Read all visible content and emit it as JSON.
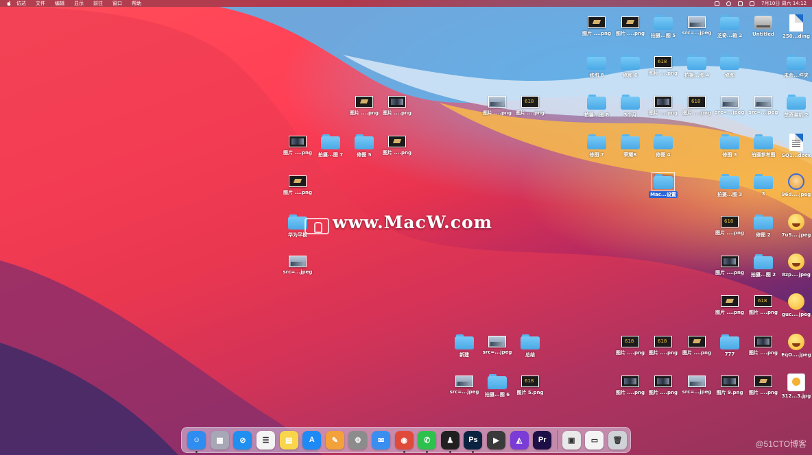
{
  "menubar": {
    "items": [
      "访达",
      "文件",
      "编辑",
      "显示",
      "前往",
      "窗口",
      "帮助"
    ],
    "clock": "7月10日 周六 14:12"
  },
  "desktop_icons": [
    {
      "label": "图片 ....png",
      "kind": "thumb",
      "style": "gold"
    },
    {
      "label": "图片 ....png",
      "kind": "thumb",
      "style": "gold"
    },
    {
      "label": "拍摄...图 5",
      "kind": "folder"
    },
    {
      "label": "src=...jpeg",
      "kind": "thumb",
      "style": "sky"
    },
    {
      "label": "芝奇...箱 2",
      "kind": "folder"
    },
    {
      "label": "Untitled",
      "kind": "drive"
    },
    {
      "label": "250...ding",
      "kind": "doc"
    },
    {
      "label": "修图 8",
      "kind": "folder"
    },
    {
      "label": "修图 6",
      "kind": "folder"
    },
    {
      "label": "图片 ....png",
      "kind": "thumb",
      "style": "six"
    },
    {
      "label": "拍摄...图 4",
      "kind": "folder"
    },
    {
      "label": "修图",
      "kind": "folder"
    },
    {
      "label": "未命...件夹",
      "kind": "folder"
    },
    {
      "label": "拍摄...图 8",
      "kind": "folder"
    },
    {
      "label": "3个月",
      "kind": "folder"
    },
    {
      "label": "图片 ....png",
      "kind": "thumb",
      "style": "dark"
    },
    {
      "label": "图片 ....png",
      "kind": "thumb",
      "style": "six"
    },
    {
      "label": "src=...jpeg",
      "kind": "thumb",
      "style": "sky"
    },
    {
      "label": "src=...jpeg",
      "kind": "thumb",
      "style": "sky"
    },
    {
      "label": "芝奇装机 2",
      "kind": "folder"
    },
    {
      "label": "修图 7",
      "kind": "folder"
    },
    {
      "label": "荣耀R",
      "kind": "folder"
    },
    {
      "label": "修图 4",
      "kind": "folder"
    },
    {
      "label": "修图 3",
      "kind": "folder"
    },
    {
      "label": "拍摄参考图",
      "kind": "folder"
    },
    {
      "label": "SQ1...docx",
      "kind": "docx"
    },
    {
      "label": "Mac...设置",
      "kind": "folder",
      "selected": true
    },
    {
      "label": "拍摄...图 3",
      "kind": "folder"
    },
    {
      "label": "3",
      "kind": "folder"
    },
    {
      "label": "96d....jpeg",
      "kind": "emoji",
      "style": "avatar"
    },
    {
      "label": "图片 ....png",
      "kind": "thumb",
      "style": "six"
    },
    {
      "label": "修图 2",
      "kind": "folder"
    },
    {
      "label": "7uS....jpeg",
      "kind": "emoji",
      "style": "fun"
    },
    {
      "label": "图片 ....png",
      "kind": "thumb",
      "style": "dark"
    },
    {
      "label": "拍摄...图 2",
      "kind": "folder"
    },
    {
      "label": "8zp....jpeg",
      "kind": "emoji",
      "style": "fun"
    },
    {
      "label": "图片 ....png",
      "kind": "thumb",
      "style": "gold"
    },
    {
      "label": "图片 ....png",
      "kind": "thumb",
      "style": "six"
    },
    {
      "label": "guc....jpeg",
      "kind": "emoji",
      "style": "plain"
    },
    {
      "label": "图片 ....png",
      "kind": "thumb",
      "style": "gold"
    },
    {
      "label": "图片 ....png",
      "kind": "thumb",
      "style": "dark"
    },
    {
      "label": "图片 ....png",
      "kind": "thumb",
      "style": "sky"
    },
    {
      "label": "图片 ....png",
      "kind": "thumb",
      "style": "six"
    },
    {
      "label": "图片 ....png",
      "kind": "thumb",
      "style": "dark"
    },
    {
      "label": "拍摄...图 7",
      "kind": "folder"
    },
    {
      "label": "修图 5",
      "kind": "folder"
    },
    {
      "label": "图片 ....png",
      "kind": "thumb",
      "style": "gold"
    },
    {
      "label": "图片 ....png",
      "kind": "thumb",
      "style": "gold"
    },
    {
      "label": "华为平板",
      "kind": "folder"
    },
    {
      "label": "src=...jpeg",
      "kind": "thumb",
      "style": "sky"
    },
    {
      "label": "新建",
      "kind": "folder"
    },
    {
      "label": "src=...jpeg",
      "kind": "thumb",
      "style": "sky"
    },
    {
      "label": "总结",
      "kind": "folder"
    },
    {
      "label": "src=...jpeg",
      "kind": "thumb",
      "style": "sky"
    },
    {
      "label": "拍摄...图 6",
      "kind": "folder"
    },
    {
      "label": "图片 5.png",
      "kind": "thumb",
      "style": "six"
    },
    {
      "label": "图片 ....png",
      "kind": "thumb",
      "style": "six"
    },
    {
      "label": "图片 ....png",
      "kind": "thumb",
      "style": "six"
    },
    {
      "label": "图片 ....png",
      "kind": "thumb",
      "style": "gold"
    },
    {
      "label": "777",
      "kind": "folder"
    },
    {
      "label": "图片 ....png",
      "kind": "thumb",
      "style": "dark"
    },
    {
      "label": "EqO....jpeg",
      "kind": "emoji",
      "style": "fun"
    },
    {
      "label": "图片 ....png",
      "kind": "thumb",
      "style": "dark"
    },
    {
      "label": "图片 ....png",
      "kind": "thumb",
      "style": "dark"
    },
    {
      "label": "src=...jpeg",
      "kind": "thumb",
      "style": "sky"
    },
    {
      "label": "图片 9.png",
      "kind": "thumb",
      "style": "dark"
    },
    {
      "label": "图片 ....png",
      "kind": "thumb",
      "style": "gold"
    },
    {
      "label": "312...3.jpg",
      "kind": "emoji",
      "style": "pic"
    }
  ],
  "watermark": "www.MacW.com",
  "credit": "@51CTO博客",
  "dock": [
    {
      "name": "finder",
      "glyph": "☺",
      "color": "#2f8cf0",
      "running": true
    },
    {
      "name": "launchpad",
      "glyph": "▦",
      "color": "#a7a7b5"
    },
    {
      "name": "safari",
      "glyph": "⊘",
      "color": "#1f8ff0"
    },
    {
      "name": "reminders",
      "glyph": "☰",
      "color": "#f4f4f4",
      "dark": true
    },
    {
      "name": "notes",
      "glyph": "▤",
      "color": "#f8d54a"
    },
    {
      "name": "app-store",
      "glyph": "A",
      "color": "#1d8af5"
    },
    {
      "name": "pages",
      "glyph": "✎",
      "color": "#f3a13a"
    },
    {
      "name": "system-preferences",
      "glyph": "⚙",
      "color": "#8c8c8c"
    },
    {
      "name": "qq-mail",
      "glyph": "✉",
      "color": "#3a8ef0"
    },
    {
      "name": "chrome",
      "glyph": "◉",
      "color": "#e04a3b",
      "running": true
    },
    {
      "name": "wechat",
      "glyph": "✆",
      "color": "#2dc24e",
      "running": true
    },
    {
      "name": "qq",
      "glyph": "♟",
      "color": "#202020",
      "running": true
    },
    {
      "name": "photoshop",
      "glyph": "Ps",
      "color": "#0b2340",
      "running": true
    },
    {
      "name": "final-cut",
      "glyph": "▶",
      "color": "#3a3a3a"
    },
    {
      "name": "affinity",
      "glyph": "◭",
      "color": "#7a3bd6"
    },
    {
      "name": "premiere",
      "glyph": "Pr",
      "color": "#1e0f47"
    },
    {
      "name": "preview",
      "glyph": "▣",
      "color": "#e9e9e9",
      "dark": true
    },
    {
      "name": "screenshot",
      "glyph": "▭",
      "color": "#f4f4f4",
      "dark": true
    },
    {
      "name": "trash",
      "glyph": "🗑",
      "color": "#cfd3d8",
      "dark": true
    }
  ]
}
